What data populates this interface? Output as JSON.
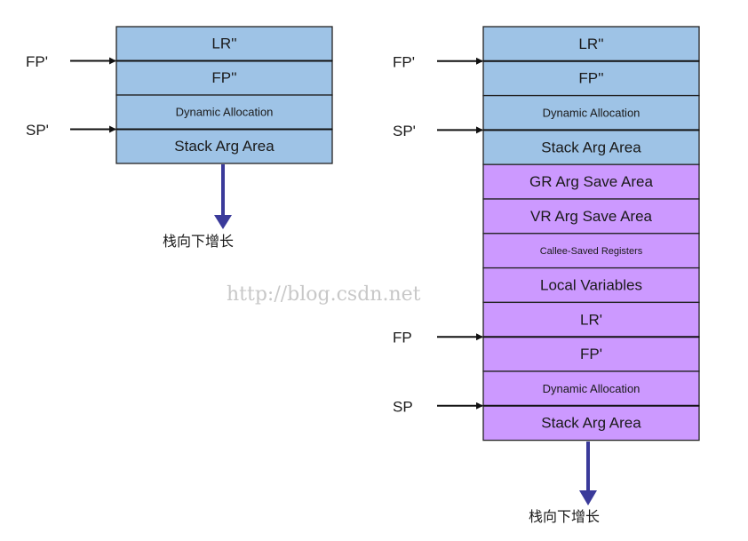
{
  "colors": {
    "blue_cell": "#9ec3e6",
    "purple_cell": "#cc99ff",
    "cell_border": "#222222",
    "arrow": "#111111",
    "growth_arrow": "#3a3a9a",
    "watermark": "#c8c8c8"
  },
  "left_stack": {
    "cells": [
      {
        "label": "LR''",
        "color": "blue",
        "size": "normal"
      },
      {
        "label": "FP''",
        "color": "blue",
        "size": "normal"
      },
      {
        "label": "Dynamic Allocation",
        "color": "blue",
        "size": "small"
      },
      {
        "label": "Stack Arg Area",
        "color": "blue",
        "size": "normal"
      }
    ],
    "pointers": [
      {
        "label": "FP'",
        "at_cell": 2
      },
      {
        "label": "SP'",
        "at_cell": 4
      }
    ],
    "growth_label": "栈向下增长"
  },
  "right_stack": {
    "cells": [
      {
        "label": "LR''",
        "color": "blue",
        "size": "normal"
      },
      {
        "label": "FP''",
        "color": "blue",
        "size": "normal"
      },
      {
        "label": "Dynamic Allocation",
        "color": "blue",
        "size": "small"
      },
      {
        "label": "Stack Arg Area",
        "color": "blue",
        "size": "normal"
      },
      {
        "label": "GR Arg Save Area",
        "color": "purple",
        "size": "normal"
      },
      {
        "label": "VR Arg Save Area",
        "color": "purple",
        "size": "normal"
      },
      {
        "label": "Callee-Saved Registers",
        "color": "purple",
        "size": "tiny"
      },
      {
        "label": "Local Variables",
        "color": "purple",
        "size": "normal"
      },
      {
        "label": "LR'",
        "color": "purple",
        "size": "normal"
      },
      {
        "label": "FP'",
        "color": "purple",
        "size": "normal"
      },
      {
        "label": "Dynamic Allocation",
        "color": "purple",
        "size": "small"
      },
      {
        "label": "Stack Arg Area",
        "color": "purple",
        "size": "normal"
      }
    ],
    "pointers": [
      {
        "label": "FP'",
        "at_cell": 2
      },
      {
        "label": "SP'",
        "at_cell": 4
      },
      {
        "label": "FP",
        "at_cell": 10
      },
      {
        "label": "SP",
        "at_cell": 12
      }
    ],
    "growth_label": "栈向下增长"
  },
  "watermark": "http://blog.csdn.net"
}
